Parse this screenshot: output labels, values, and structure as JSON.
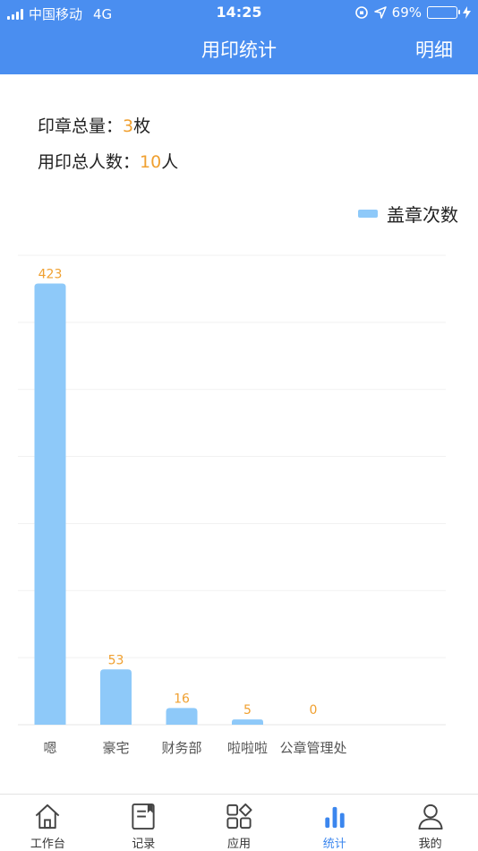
{
  "status_bar": {
    "carrier": "中国移动",
    "network": "4G",
    "time": "14:25",
    "battery": "69%"
  },
  "header": {
    "title": "用印统计",
    "right_action": "明细"
  },
  "summary": {
    "seal_total_label": "印章总量：",
    "seal_total_value": "3",
    "seal_total_unit": "枚",
    "user_total_label": "用印总人数：",
    "user_total_value": "10",
    "user_total_unit": "人"
  },
  "colors": {
    "header_bg": "#4a8ef0",
    "bar": "#8ec9f9",
    "value_label": "#f0a030",
    "active_tab": "#3b86ee"
  },
  "chart_data": {
    "type": "bar",
    "categories": [
      "嗯",
      "豪宅",
      "财务部",
      "啦啦啦",
      "公章管理处"
    ],
    "series": [
      {
        "name": "盖章次数",
        "values": [
          423,
          53,
          16,
          5,
          0
        ]
      }
    ],
    "legend_position": "top-right",
    "ylim": [
      0,
      450
    ],
    "grid": true,
    "data_labels": true
  },
  "tabbar": {
    "items": [
      {
        "label": "工作台",
        "icon": "home-icon"
      },
      {
        "label": "记录",
        "icon": "record-icon"
      },
      {
        "label": "应用",
        "icon": "apps-icon"
      },
      {
        "label": "统计",
        "icon": "stats-icon",
        "active": true
      },
      {
        "label": "我的",
        "icon": "profile-icon"
      }
    ]
  }
}
